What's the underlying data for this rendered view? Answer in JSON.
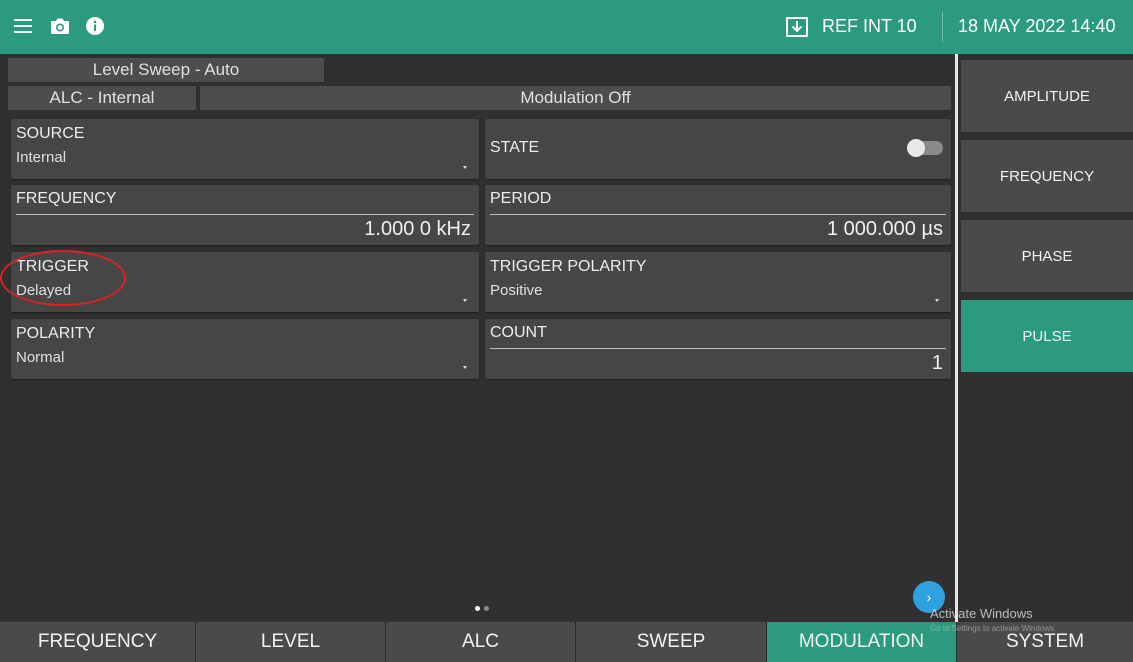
{
  "topbar": {
    "icons": [
      "menu-icon",
      "camera-icon",
      "info-icon",
      "download-icon"
    ],
    "ref_label": "REF INT 10",
    "datetime": "18 MAY 2022 14:40"
  },
  "status": {
    "sweep": "Level Sweep - Auto",
    "alc": "ALC - Internal",
    "modulation": "Modulation Off"
  },
  "params": {
    "source": {
      "label": "SOURCE",
      "value": "Internal"
    },
    "state": {
      "label": "STATE",
      "on": false
    },
    "frequency": {
      "label": "FREQUENCY",
      "value": "1.000 0 kHz"
    },
    "period": {
      "label": "PERIOD",
      "value": "1 000.000 µs"
    },
    "trigger": {
      "label": "TRIGGER",
      "value": "Delayed"
    },
    "trigger_polarity": {
      "label": "TRIGGER POLARITY",
      "value": "Positive"
    },
    "polarity": {
      "label": "POLARITY",
      "value": "Normal"
    },
    "count": {
      "label": "COUNT",
      "value": "1"
    }
  },
  "right_menu": {
    "items": [
      "AMPLITUDE",
      "FREQUENCY",
      "PHASE",
      "PULSE"
    ],
    "active": "PULSE"
  },
  "pager": {
    "pages": 2,
    "current": 1
  },
  "bottom_tabs": {
    "items": [
      "FREQUENCY",
      "LEVEL",
      "ALC",
      "SWEEP",
      "MODULATION",
      "SYSTEM"
    ],
    "active": "MODULATION"
  },
  "watermark": {
    "line1": "Activate Windows",
    "line2": "Go to Settings to activate Windows."
  },
  "colors": {
    "accent": "#2b9a7e",
    "background": "#303030",
    "tile": "#464646",
    "annotation": "#d92323",
    "nav_button": "#2fa0e0"
  }
}
